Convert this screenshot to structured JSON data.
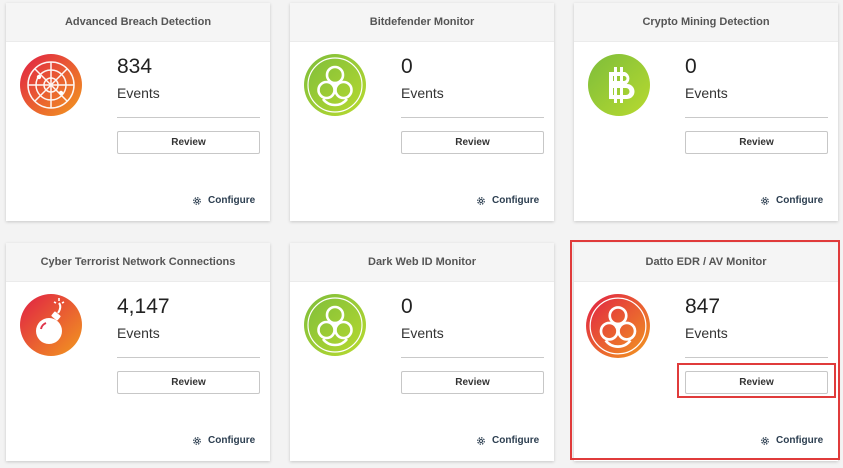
{
  "cards": [
    {
      "title": "Advanced Breach Detection",
      "count": "834",
      "events_label": "Events",
      "review_label": "Review",
      "configure_label": "Configure",
      "icon": "radar-icon"
    },
    {
      "title": "Bitdefender Monitor",
      "count": "0",
      "events_label": "Events",
      "review_label": "Review",
      "configure_label": "Configure",
      "icon": "biohazard-icon"
    },
    {
      "title": "Crypto Mining Detection",
      "count": "0",
      "events_label": "Events",
      "review_label": "Review",
      "configure_label": "Configure",
      "icon": "bitcoin-icon"
    },
    {
      "title": "Cyber Terrorist Network Connections",
      "count": "4,147",
      "events_label": "Events",
      "review_label": "Review",
      "configure_label": "Configure",
      "icon": "bomb-icon"
    },
    {
      "title": "Dark Web ID Monitor",
      "count": "0",
      "events_label": "Events",
      "review_label": "Review",
      "configure_label": "Configure",
      "icon": "biohazard-icon"
    },
    {
      "title": "Datto EDR / AV Monitor",
      "count": "847",
      "events_label": "Events",
      "review_label": "Review",
      "configure_label": "Configure",
      "icon": "biohazard-icon"
    }
  ],
  "colors": {
    "alert_gradient_start": "#e01f45",
    "alert_gradient_end": "#f29a1f",
    "ok_gradient_start": "#8cc63f",
    "ok_gradient_end": "#b5d930",
    "highlight": "#e03b3b"
  }
}
